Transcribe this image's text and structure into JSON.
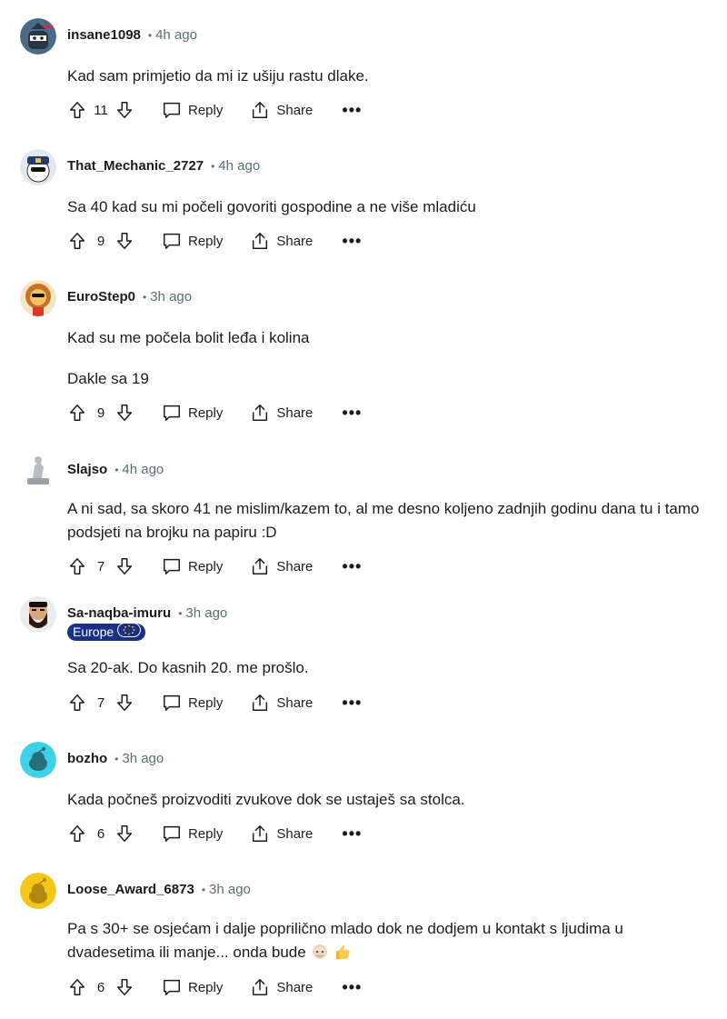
{
  "actions": {
    "reply_label": "Reply",
    "share_label": "Share",
    "more_label": "•••"
  },
  "comments": [
    {
      "username": "insane1098",
      "time": "4h ago",
      "paragraphs": [
        "Kad sam primjetio da mi iz ušiju rastu dlake."
      ],
      "votes": "11",
      "avatar": "ninja-avatar"
    },
    {
      "username": "That_Mechanic_2727",
      "time": "4h ago",
      "paragraphs": [
        "Sa 40 kad su mi počeli govoriti gospodine a ne više mladiću"
      ],
      "votes": "9",
      "avatar": "police-avatar"
    },
    {
      "username": "EuroStep0",
      "time": "3h ago",
      "paragraphs": [
        "Kad su me počela bolit leđa i kolina",
        "Dakle sa 19"
      ],
      "votes": "9",
      "avatar": "lion-avatar"
    },
    {
      "username": "Slajso",
      "time": "4h ago",
      "paragraphs": [
        "A ni sad, sa skoro 41 ne mislim/kazem to, al me desno koljeno zadnjih godinu dana tu i tamo podsjeti na brojku na papiru :D"
      ],
      "votes": "7",
      "avatar": "statue-avatar"
    },
    {
      "username": "Sa-naqba-imuru",
      "time": "3h ago",
      "flair": "Europe",
      "paragraphs": [
        "Sa 20-ak. Do kasnih 20. me prošlo."
      ],
      "votes": "7",
      "avatar": "bearded-avatar"
    },
    {
      "username": "bozho",
      "time": "3h ago",
      "paragraphs": [
        "Kada počneš proizvoditi zvukove dok se ustaješ sa stolca."
      ],
      "votes": "6",
      "avatar": "snoo-cyan-avatar"
    },
    {
      "username": "Loose_Award_6873",
      "time": "3h ago",
      "paragraphs": [
        "Pa s 30+ se osjećam i dalje poprilično mlado dok ne dodjem u kontakt s ljudima u dvadesetima ili manje... onda bude"
      ],
      "votes": "6",
      "avatar": "snoo-yellow-avatar",
      "emojis": [
        "old-man-emoji",
        "thumbs-up-emoji"
      ]
    }
  ],
  "colors": {
    "meta_gray": "#576f76",
    "flair_bg": "#1a2f86",
    "text": "#1c1c1c"
  }
}
